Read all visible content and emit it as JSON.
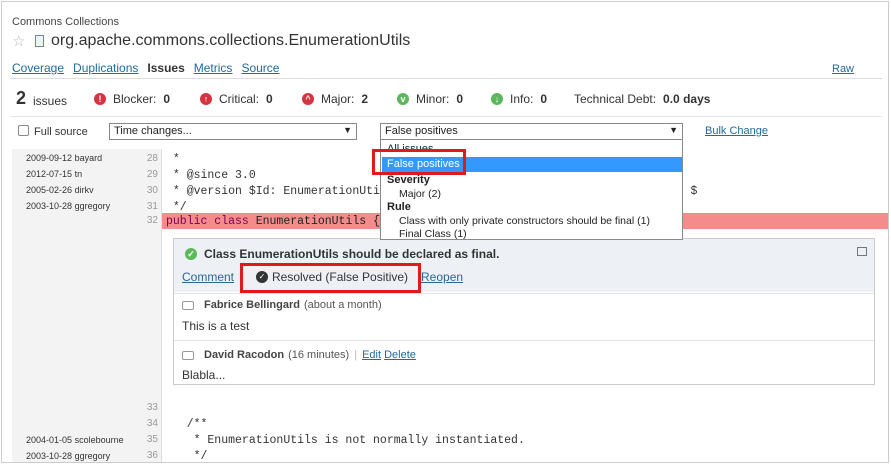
{
  "header": {
    "project": "Commons Collections",
    "file_title": "org.apache.commons.collections.EnumerationUtils",
    "tabs": [
      "Coverage",
      "Duplications",
      "Issues",
      "Metrics",
      "Source"
    ],
    "active_tab": "Issues",
    "raw_label": "Raw"
  },
  "summary": {
    "count": "2",
    "count_label": "issues",
    "severities": [
      {
        "label": "Blocker:",
        "value": "0",
        "icon": "blocker-icon"
      },
      {
        "label": "Critical:",
        "value": "0",
        "icon": "critical-icon"
      },
      {
        "label": "Major:",
        "value": "2",
        "icon": "major-icon"
      },
      {
        "label": "Minor:",
        "value": "0",
        "icon": "minor-icon"
      },
      {
        "label": "Info:",
        "value": "0",
        "icon": "info-icon"
      }
    ],
    "debt_label": "Technical Debt:",
    "debt_value": "0.0 days"
  },
  "filters": {
    "full_source_label": "Full source",
    "time_select": "Time changes...",
    "issue_select": "False positives",
    "bulk_change": "Bulk Change"
  },
  "dropdown": {
    "options": [
      {
        "label": "All issues",
        "kind": "opt"
      },
      {
        "label": "False positives",
        "kind": "opt",
        "selected": true
      },
      {
        "label": "Severity",
        "kind": "grp"
      },
      {
        "label": "Major (2)",
        "kind": "sub"
      },
      {
        "label": "Rule",
        "kind": "grp"
      },
      {
        "label": "Class with only private constructors should be final (1)",
        "kind": "sub"
      },
      {
        "label": "Final Class (1)",
        "kind": "sub"
      }
    ]
  },
  "source": {
    "blame": [
      {
        "date": "2009-09-12",
        "author": "bayard"
      },
      {
        "date": "2012-07-15",
        "author": "tn"
      },
      {
        "date": "2005-02-26",
        "author": "dirkv"
      },
      {
        "date": "2003-10-28",
        "author": "ggregory"
      }
    ],
    "lines_top": [
      {
        "num": "28",
        "code": " *"
      },
      {
        "num": "29",
        "code": " * @since 3.0"
      },
      {
        "num": "30",
        "code": " * @version $Id: EnumerationUtils.java 1361710 2012-07-15 15:00:21Z tn $ory $"
      },
      {
        "num": "31",
        "code": " */"
      }
    ],
    "highlight_num": "32",
    "highlight_kw": "public class",
    "highlight_rest": " EnumerationUtils {",
    "lines_bottom": [
      {
        "num": "33",
        "code": ""
      },
      {
        "num": "34",
        "code": "   /**"
      },
      {
        "num": "35",
        "code": "    * EnumerationUtils is not normally instantiated."
      },
      {
        "num": "36",
        "code": "    */"
      }
    ],
    "blame_bottom": [
      {
        "date": "2004-01-05",
        "author": "scolebourne"
      },
      {
        "date": "2003-10-28",
        "author": "ggregory"
      }
    ]
  },
  "issue": {
    "title": "Class EnumerationUtils should be declared as final.",
    "comment_action": "Comment",
    "status": "Resolved (False Positive)",
    "reopen": "Reopen",
    "comments": [
      {
        "author": "Fabrice Bellingard",
        "time": "(about a month)",
        "text": "This is a test"
      },
      {
        "author": "David Racodon",
        "time": "(16 minutes)",
        "edit": "Edit",
        "delete": "Delete",
        "text": "Blabla..."
      }
    ]
  }
}
